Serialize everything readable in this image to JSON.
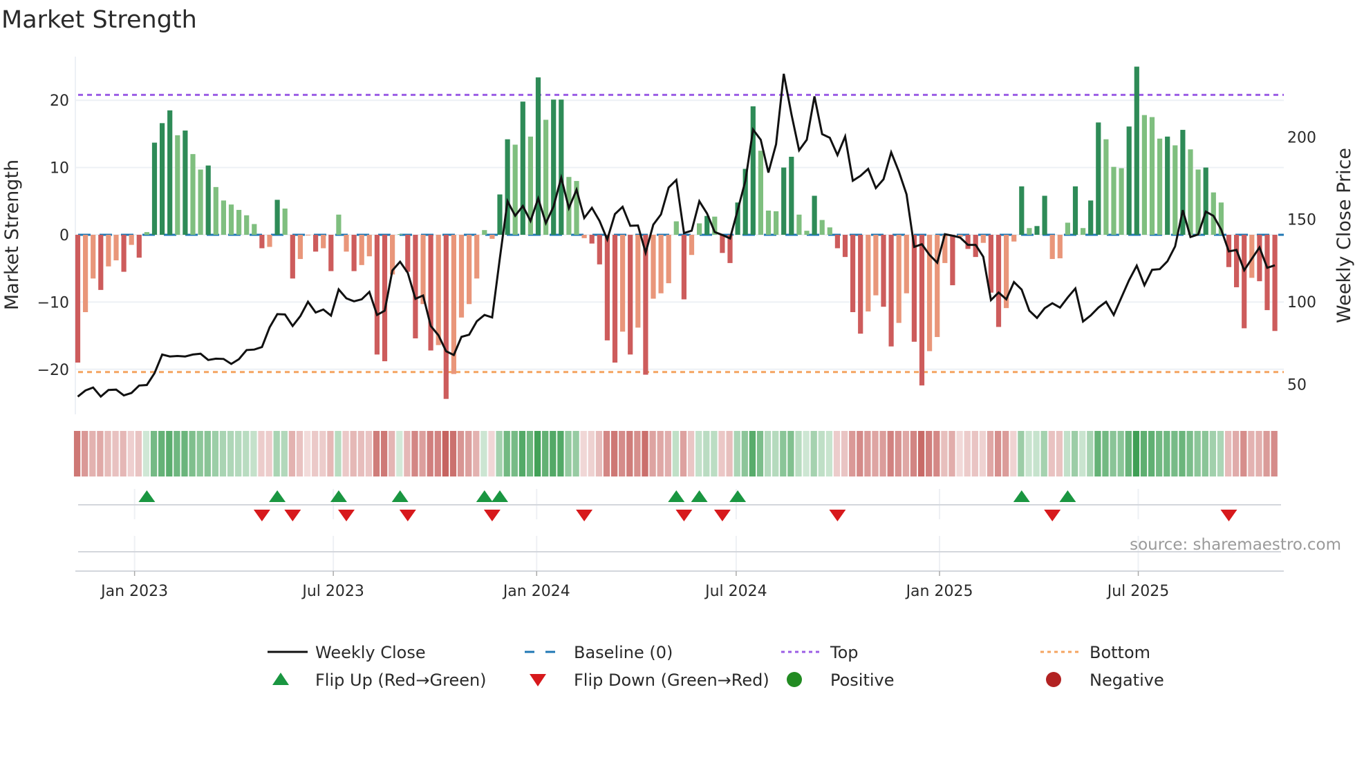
{
  "chart_data": {
    "type": "bar",
    "title": "Market Strength",
    "ylabel": "Market Strength",
    "y2label": "Weekly Close Price",
    "ylim": [
      -26.7,
      26.5
    ],
    "y2lim": [
      26,
      248
    ],
    "yticks": [
      {
        "v": 20,
        "label": "20"
      },
      {
        "v": 10,
        "label": "10"
      },
      {
        "v": 0,
        "label": "0"
      },
      {
        "v": -10,
        "label": "−10"
      },
      {
        "v": -20,
        "label": "−20"
      }
    ],
    "y2ticks": [
      {
        "v": 200,
        "label": "200"
      },
      {
        "v": 150,
        "label": "150"
      },
      {
        "v": 100,
        "label": "100"
      },
      {
        "v": 50,
        "label": "50"
      }
    ],
    "xticks": [
      {
        "week": 7.4,
        "label": "Jan 2023"
      },
      {
        "week": 33.3,
        "label": "Jul 2023"
      },
      {
        "week": 59.8,
        "label": "Jan 2024"
      },
      {
        "week": 85.8,
        "label": "Jul 2024"
      },
      {
        "week": 112.3,
        "label": "Jan 2025"
      },
      {
        "week": 138.2,
        "label": "Jul 2025"
      }
    ],
    "top_level": 20.8,
    "bottom_level": -20.4,
    "baseline": 0,
    "strength": [
      -19,
      -11.5,
      -6.5,
      -8.2,
      -4.7,
      -3.8,
      -5.5,
      -1.5,
      -3.4,
      0.4,
      13.7,
      16.6,
      18.5,
      14.8,
      15.5,
      12,
      9.7,
      10.3,
      7.1,
      5.1,
      4.5,
      3.7,
      2.9,
      1.6,
      -2,
      -1.8,
      5.2,
      3.9,
      -6.5,
      -3.6,
      -0.1,
      -2.5,
      -2,
      -5.4,
      3,
      -2.5,
      -5.4,
      -4.5,
      -3.2,
      -17.8,
      -18.8,
      -5.9,
      0.1,
      -5.5,
      -15.4,
      -10.3,
      -17.2,
      -16.4,
      -24.4,
      -20.7,
      -12.3,
      -10.3,
      -6.5,
      0.7,
      -0.6,
      6,
      14.2,
      13.4,
      19.8,
      14.6,
      23.4,
      17.1,
      20.1,
      20.1,
      8.6,
      8.0,
      -0.5,
      -1.3,
      -4.4,
      -15.7,
      -19,
      -14.4,
      -17.8,
      -13.8,
      -20.8,
      -9.5,
      -8.7,
      -7.2,
      2.0,
      -9.6,
      -3,
      1.7,
      2.8,
      2.7,
      -2.7,
      -4.2,
      4.8,
      9.8,
      19.1,
      12.5,
      3.6,
      3.5,
      10,
      11.6,
      3,
      0.6,
      5.8,
      2.2,
      1.1,
      -2,
      -3.3,
      -11.5,
      -14.7,
      -11.4,
      -9,
      -10.7,
      -16.6,
      -13.1,
      -8.7,
      -15.9,
      -22.4,
      -17.3,
      -15.2,
      -4.2,
      -7.5,
      -0.3,
      -2.1,
      -3.3,
      -1.2,
      -8.6,
      -13.7,
      -10.9,
      -1.0,
      7.2,
      1.0,
      1.3,
      5.8,
      -3.6,
      -3.5,
      1.8,
      7.2,
      1.0,
      5.1,
      16.7,
      14.2,
      10.1,
      9.9,
      16.1,
      25,
      17.8,
      17.5,
      14.3,
      14.6,
      13.3,
      15.6,
      12.7,
      9.7,
      10,
      6.3,
      4.8,
      -4.8,
      -7.8,
      -13.9,
      -6.4,
      -6.9,
      -11.2,
      -14.3
    ],
    "weekly_close": [
      42.5,
      46.2,
      48,
      42.5,
      46.5,
      46.7,
      43.2,
      44.7,
      49.2,
      49.5,
      56.7,
      68,
      66.8,
      67.1,
      66.8,
      68,
      68.5,
      64.7,
      65.5,
      65.3,
      62.3,
      65.2,
      70.7,
      71,
      72.5,
      84.5,
      92.5,
      92.3,
      85.3,
      91.3,
      100,
      93.5,
      95.3,
      91.6,
      107.5,
      102.1,
      100.3,
      101.5,
      106,
      92,
      94.6,
      119,
      124.3,
      117.6,
      101.8,
      103.8,
      85.3,
      79.7,
      70,
      67.7,
      78.7,
      80,
      88.2,
      92,
      90.5,
      126.3,
      161,
      152.2,
      158.1,
      149,
      162.7,
      147.7,
      157.8,
      175.3,
      156.8,
      168,
      150.8,
      157,
      149,
      137.8,
      153.2,
      157.6,
      146.1,
      146.3,
      129.8,
      146.8,
      153,
      169.3,
      173.9,
      141.7,
      143.1,
      161,
      153.6,
      142.3,
      140.5,
      138.4,
      155.7,
      173.3,
      204.5,
      198.3,
      178.4,
      195.6,
      238.3,
      213.8,
      191.9,
      198.3,
      224.6,
      201.7,
      199.5,
      189,
      200.3,
      173.4,
      176.4,
      180.6,
      169,
      174.3,
      190.7,
      179,
      165.2,
      133.3,
      134.9,
      128.4,
      123.7,
      141,
      140.1,
      138.9,
      134.5,
      134.5,
      127.3,
      101,
      105.6,
      101.5,
      112,
      107.4,
      94.6,
      90.2,
      96.1,
      99.1,
      96.5,
      102.6,
      108.1,
      88,
      91.7,
      96.5,
      100,
      92,
      102.6,
      113.1,
      121.9,
      110,
      119.4,
      119.8,
      124.6,
      133.6,
      155.6,
      139.3,
      140.8,
      154.7,
      152.1,
      143.8,
      130.6,
      131.4,
      119.1,
      126.1,
      133,
      120.6,
      122.1
    ],
    "legend": [
      {
        "label": "Weekly Close",
        "symbol": "line"
      },
      {
        "label": "Baseline (0)",
        "symbol": "dash"
      },
      {
        "label": "Top",
        "symbol": "dot-purple"
      },
      {
        "label": "Bottom",
        "symbol": "dot-orange"
      },
      {
        "label": "Flip Up (Red→Green)",
        "symbol": "triangle-up"
      },
      {
        "label": "Flip Down (Green→Red)",
        "symbol": "triangle-down"
      },
      {
        "label": "Positive",
        "symbol": "circle-green"
      },
      {
        "label": "Negative",
        "symbol": "circle-red"
      }
    ],
    "legend_position": "bottom",
    "grid": true,
    "source": "source: sharemaestro.com"
  },
  "colors": {
    "pos_strong": "#2e8b57",
    "pos_weak": "#7fbf7f",
    "neg_strong": "#cd5c5c",
    "neg_weak": "#e9967a",
    "line": "#111111",
    "baseline": "#1f77b4",
    "top": "#9b5de5",
    "bottom": "#f4a460",
    "flip_up": "#1a9641",
    "flip_down": "#d7191c",
    "positive": "#228b22",
    "negative": "#b22222"
  }
}
